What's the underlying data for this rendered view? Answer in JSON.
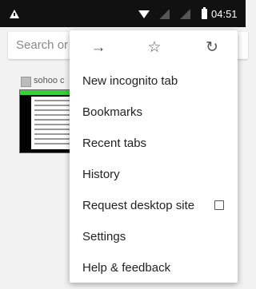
{
  "status_bar": {
    "time": "04:51"
  },
  "address_bar": {
    "placeholder": "Search or"
  },
  "tab_preview": {
    "title": "sohoo c"
  },
  "menu": {
    "toolbar": {
      "forward_icon": "arrow-right-icon",
      "bookmark_icon": "star-icon",
      "reload_icon": "reload-icon"
    },
    "items": [
      {
        "label": "New incognito tab"
      },
      {
        "label": "Bookmarks"
      },
      {
        "label": "Recent tabs"
      },
      {
        "label": "History"
      },
      {
        "label": "Request desktop site",
        "checkbox": false
      },
      {
        "label": "Settings"
      },
      {
        "label": "Help & feedback"
      }
    ]
  }
}
